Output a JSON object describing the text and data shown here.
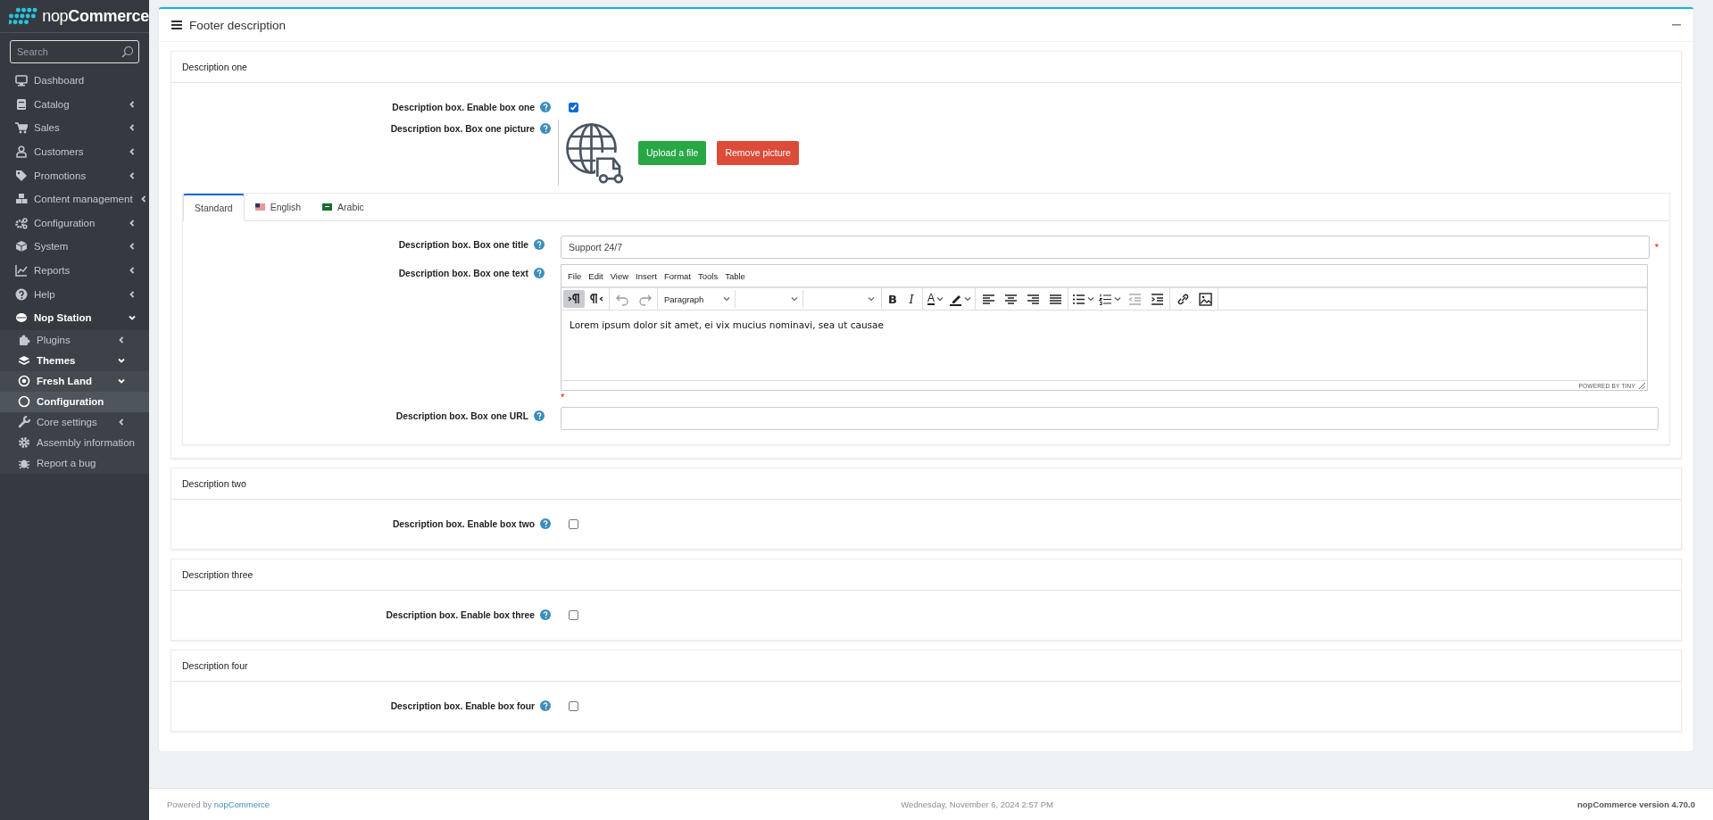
{
  "brand": {
    "prefix": "nop",
    "name": "Commerce"
  },
  "search": {
    "placeholder": "Search"
  },
  "sidebar": {
    "items": [
      {
        "label": "Dashboard",
        "active": false,
        "selected": false
      },
      {
        "label": "Catalog",
        "active": false,
        "selected": false,
        "expanded": false
      },
      {
        "label": "Sales",
        "active": false,
        "selected": false,
        "expanded": false
      },
      {
        "label": "Customers",
        "active": false,
        "selected": false,
        "expanded": false
      },
      {
        "label": "Promotions",
        "active": false,
        "selected": false,
        "expanded": false
      },
      {
        "label": "Content management",
        "active": false,
        "selected": false,
        "expanded": false
      },
      {
        "label": "Configuration",
        "active": false,
        "selected": false,
        "expanded": false
      },
      {
        "label": "System",
        "active": false,
        "selected": false,
        "expanded": false
      },
      {
        "label": "Reports",
        "active": false,
        "selected": false,
        "expanded": false
      },
      {
        "label": "Help",
        "active": false,
        "selected": false,
        "expanded": false
      },
      {
        "label": "Nop Station",
        "active": true,
        "selected": false,
        "expanded": true,
        "children": [
          {
            "label": "Plugins",
            "active": false,
            "selected": false,
            "expanded": false
          },
          {
            "label": "Themes",
            "active": true,
            "selected": false,
            "expanded": true,
            "children": [
              {
                "label": "Fresh Land",
                "active": true,
                "selected": false,
                "expanded": true,
                "children": [
                  {
                    "label": "Configuration",
                    "active": true,
                    "selected": true
                  }
                ]
              }
            ]
          },
          {
            "label": "Core settings",
            "active": false,
            "selected": false,
            "expanded": false
          },
          {
            "label": "Assembly information",
            "active": false,
            "selected": false
          },
          {
            "label": "Report a bug",
            "active": false,
            "selected": false
          }
        ]
      }
    ]
  },
  "panel": {
    "title": "Footer description",
    "expanded": true,
    "sections": [
      {
        "title": "Description one",
        "fields": [
          {
            "kind": "checkbox",
            "label": "Description box. Enable box one",
            "checked": true
          },
          {
            "kind": "picture",
            "label": "Description box. Box one picture",
            "buttons": [
              {
                "kind": "upload",
                "label": "Upload a file"
              },
              {
                "kind": "remove",
                "label": "Remove picture"
              }
            ]
          }
        ],
        "locales": {
          "tabs": [
            {
              "label": "Standard",
              "selected": true
            },
            {
              "label": "English",
              "selected": false
            },
            {
              "label": "Arabic",
              "selected": false
            }
          ],
          "fields": [
            {
              "kind": "text",
              "label": "Description box. Box one title",
              "value": "Support 24/7",
              "required_mark": "*"
            },
            {
              "kind": "editor",
              "label": "Description box. Box one text",
              "required_mark": "*",
              "menu": [
                "File",
                "Edit",
                "View",
                "Insert",
                "Format",
                "Tools",
                "Table"
              ],
              "toolbar": [
                [
                  {
                    "kind": "ltr",
                    "pressed": true
                  },
                  {
                    "kind": "rtl",
                    "pressed": false
                  }
                ],
                [
                  {
                    "kind": "undo",
                    "pressed": false
                  },
                  {
                    "kind": "redo",
                    "pressed": false
                  }
                ],
                [
                  {
                    "kind": "select",
                    "value": "Paragraph"
                  },
                  {
                    "kind": "select"
                  },
                  {
                    "kind": "select"
                  }
                ],
                [
                  {
                    "kind": "glyph",
                    "text": "B",
                    "pressed": false
                  },
                  {
                    "kind": "glyph-italic",
                    "text": "I",
                    "pressed": false
                  }
                ],
                [
                  {
                    "kind": "textcolor",
                    "text": "A",
                    "pressed": false
                  },
                  {
                    "kind": "highlight",
                    "pressed": false
                  }
                ],
                [
                  {
                    "kind": "alignleft",
                    "pressed": false
                  },
                  {
                    "kind": "aligncenter",
                    "pressed": false
                  },
                  {
                    "kind": "alignright",
                    "pressed": false
                  },
                  {
                    "kind": "justify",
                    "pressed": false
                  }
                ],
                [
                  {
                    "kind": "bullist",
                    "pressed": false
                  },
                  {
                    "kind": "numlist",
                    "pressed": false
                  },
                  {
                    "kind": "outdent",
                    "pressed": false
                  },
                  {
                    "kind": "indent",
                    "pressed": false
                  }
                ],
                [
                  {
                    "kind": "link",
                    "pressed": false
                  },
                  {
                    "kind": "image",
                    "pressed": false
                  }
                ]
              ],
              "content": "Lorem ipsum dolor sit amet, ei vix mucius nominavi, sea ut causae",
              "status": "POWERED BY TINY"
            },
            {
              "kind": "text",
              "label": "Description box. Box one URL"
            }
          ]
        }
      },
      {
        "title": "Description two",
        "fields": [
          {
            "kind": "checkbox",
            "label": "Description box. Enable box two",
            "checked": false
          }
        ]
      },
      {
        "title": "Description three",
        "fields": [
          {
            "kind": "checkbox",
            "label": "Description box. Enable box three",
            "checked": false
          }
        ]
      },
      {
        "title": "Description four",
        "fields": [
          {
            "kind": "checkbox",
            "label": "Description box. Enable box four",
            "checked": false
          }
        ]
      }
    ]
  },
  "footer": {
    "powered_by": "Powered by",
    "link": "nopCommerce",
    "date": "Wednesday, November 6, 2024 2:57 PM",
    "version": "nopCommerce version 4.70.0"
  }
}
